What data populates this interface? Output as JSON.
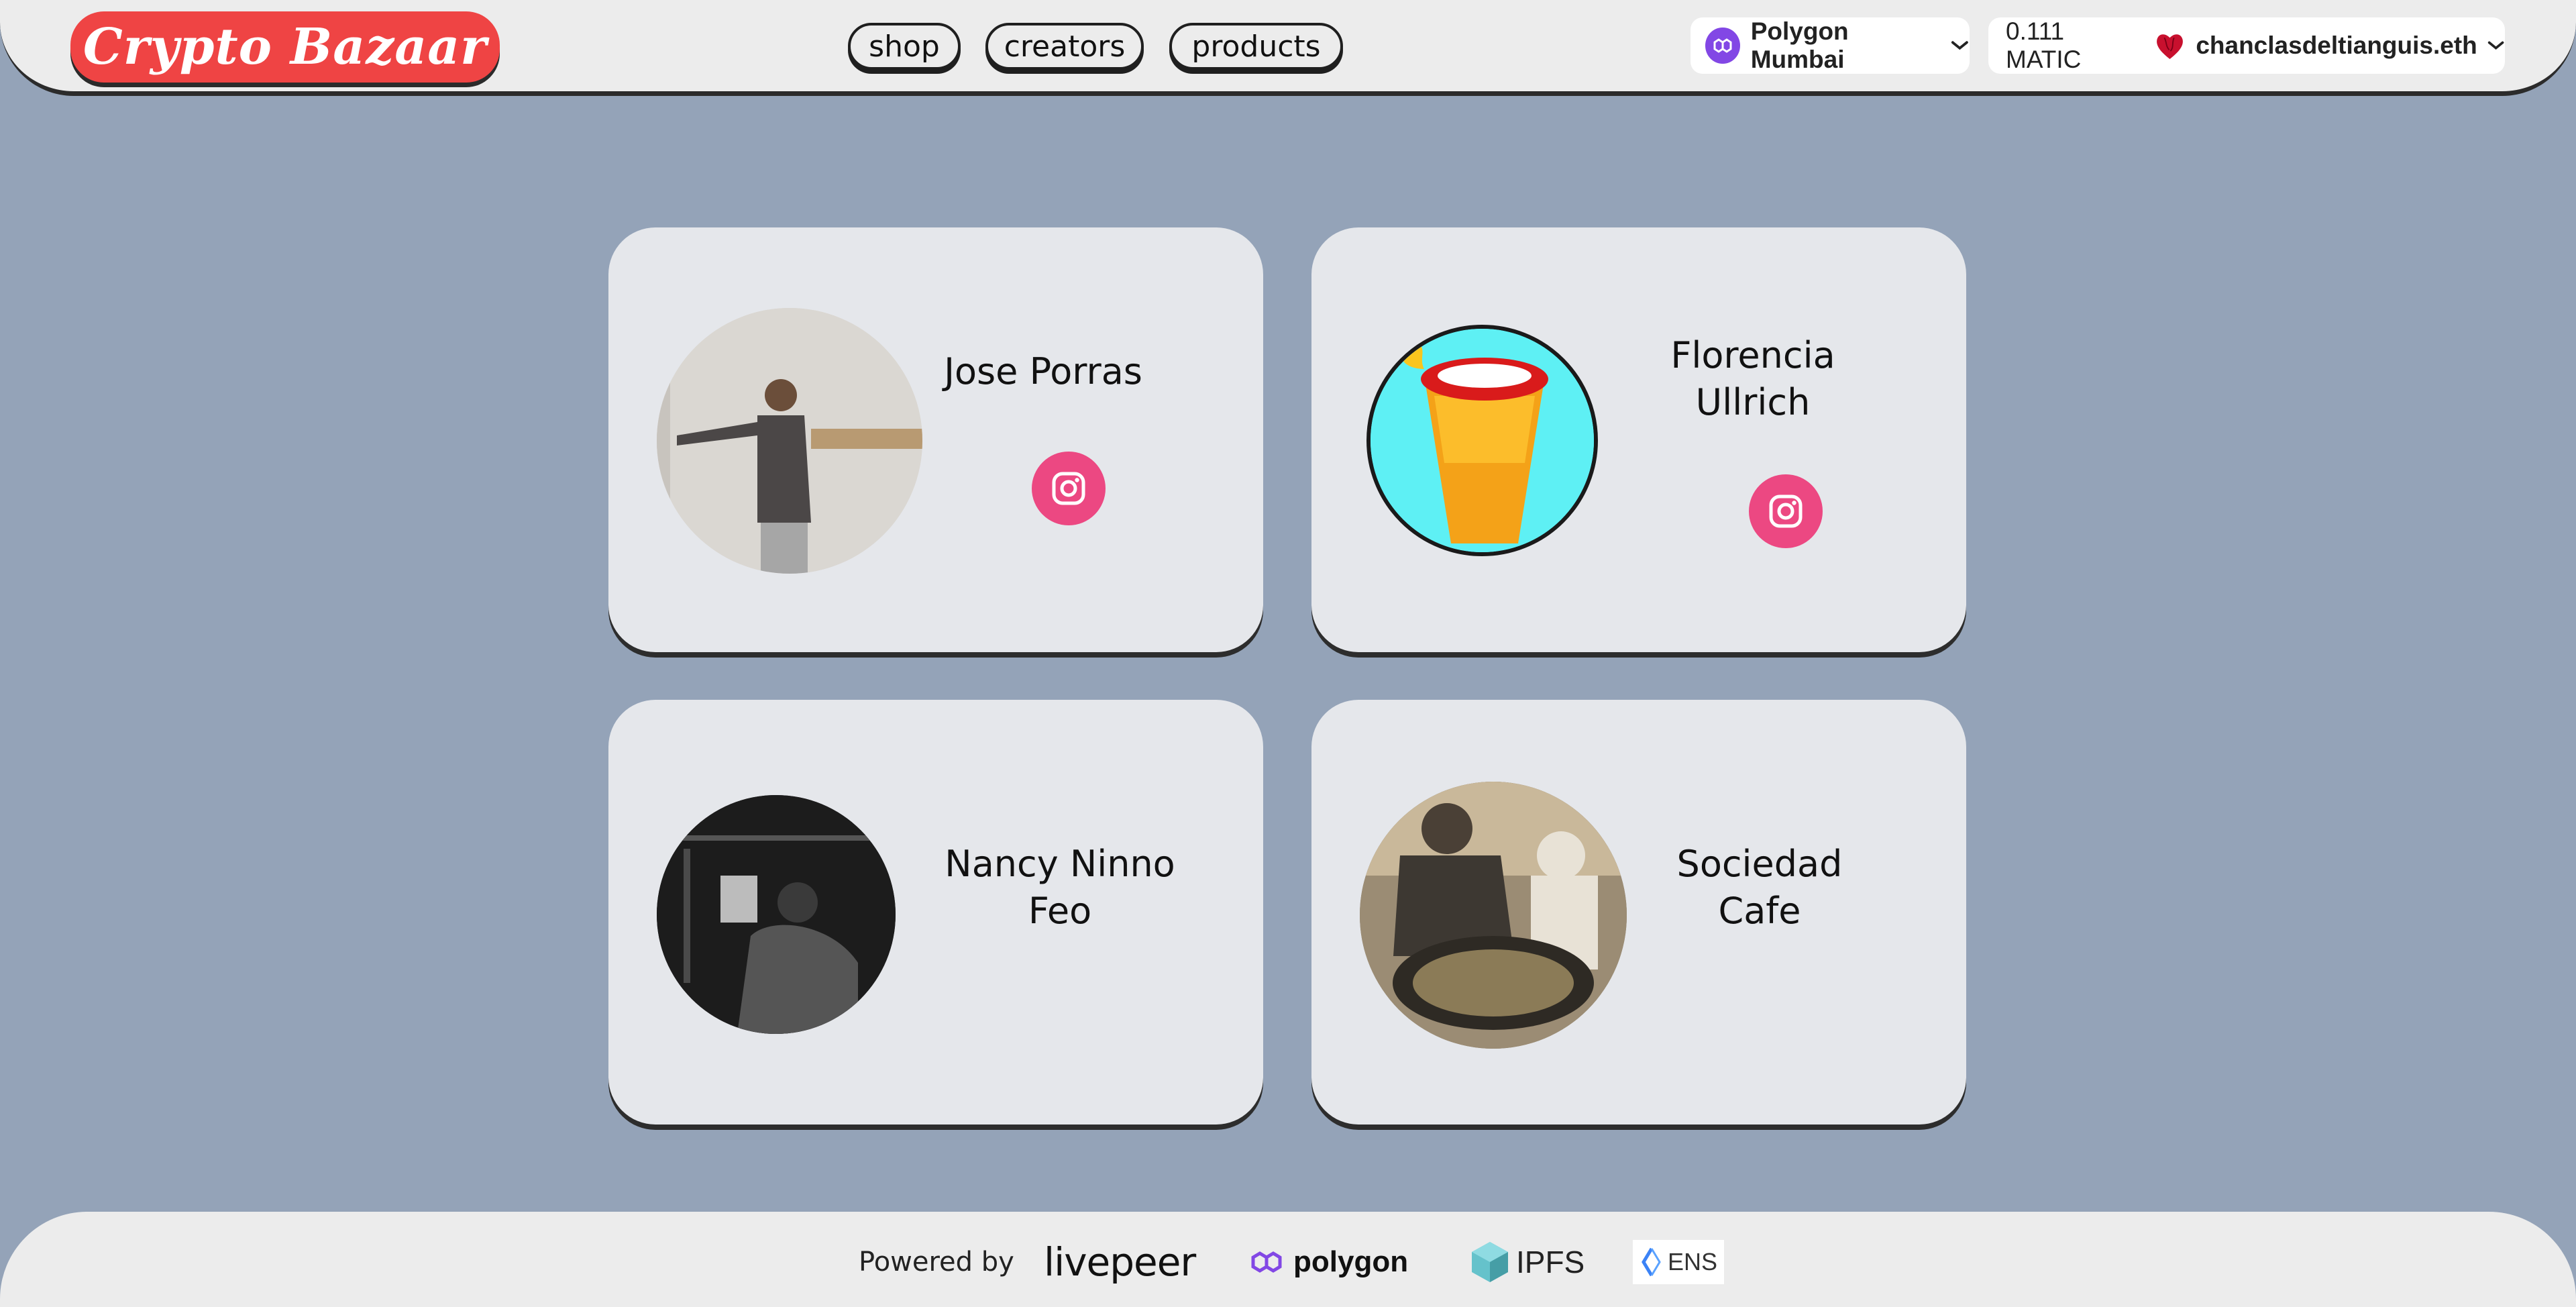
{
  "header": {
    "logo_text": "Crypto Bazaar",
    "nav": [
      {
        "label": "shop"
      },
      {
        "label": "creators"
      },
      {
        "label": "products"
      }
    ],
    "network": {
      "label": "Polygon Mumbai",
      "icon": "polygon-icon"
    },
    "wallet": {
      "balance": "0.111 MATIC",
      "account": "chanclasdeltianguis.eth",
      "icon": "heart-avatar-icon"
    }
  },
  "creators": [
    {
      "name": "Jose Porras",
      "has_instagram": true
    },
    {
      "name": "Florencia Ullrich",
      "has_instagram": true
    },
    {
      "name": "Nancy Ninno Feo",
      "has_instagram": false
    },
    {
      "name": "Sociedad Cafe",
      "has_instagram": false
    }
  ],
  "footer": {
    "powered_label": "Powered by",
    "logos": [
      "livepeer",
      "polygon",
      "IPFS",
      "ENS"
    ]
  },
  "colors": {
    "background": "#94a3b8",
    "header_bg": "#ececec",
    "logo_red": "#ef4444",
    "card_bg": "#e5e7eb",
    "instagram_pink": "#ec4882",
    "polygon_purple": "#8247e5"
  }
}
